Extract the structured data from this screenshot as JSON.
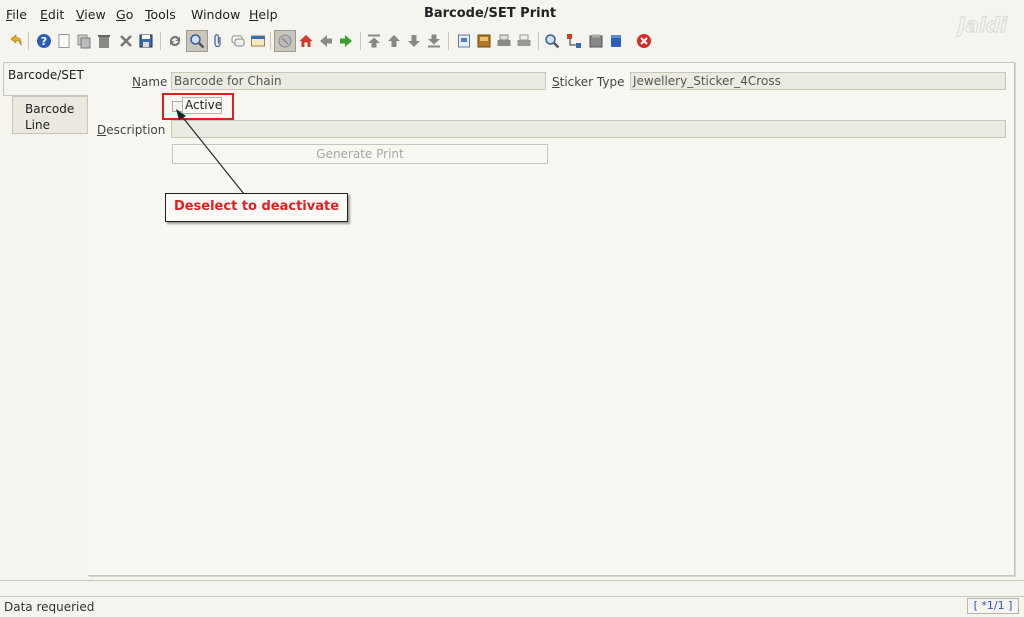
{
  "menu": {
    "file": {
      "u": "F",
      "rest": "ile"
    },
    "edit": {
      "u": "E",
      "rest": "dit"
    },
    "view": {
      "u": "V",
      "rest": "iew"
    },
    "go": {
      "u": "G",
      "rest": "o"
    },
    "tools": {
      "u": "T",
      "rest": "ools"
    },
    "window": "Window",
    "help": {
      "u": "H",
      "rest": "elp"
    }
  },
  "window_title": "Barcode/SET Print",
  "logo_text": "Jaldi",
  "tabs": [
    {
      "label": "Barcode/SET"
    },
    {
      "label_line1": "Barcode",
      "label_line2": "Line"
    }
  ],
  "form": {
    "name_label": {
      "u": "N",
      "rest": "ame"
    },
    "name_value": "Barcode for Chain",
    "sticker_label": {
      "u": "S",
      "rest": "ticker Type"
    },
    "sticker_value": "Jewellery_Sticker_4Cross",
    "active_label": "Active",
    "description_label": {
      "u": "D",
      "rest": "escription"
    },
    "description_value": "",
    "generate_button": "Generate Print"
  },
  "callout": {
    "text": "Deselect to deactivate",
    "color": "#e02020"
  },
  "status": {
    "message": "Data requeried",
    "position": "[ *1/1 ]"
  },
  "icons": [
    "undo-icon",
    "help-icon",
    "new-icon",
    "copy-icon",
    "delete-icon",
    "delete-selection-icon",
    "save-icon",
    "refresh-icon",
    "find-icon",
    "attachment-icon",
    "chat-icon",
    "history-icon",
    "grid-toggle-icon",
    "home-icon",
    "back-icon",
    "forward-icon",
    "first-record-icon",
    "previous-record-icon",
    "next-record-icon",
    "last-record-icon",
    "report-icon",
    "archive-icon",
    "print-icon",
    "print-preview-icon",
    "zoom-across-icon",
    "workflow-icon",
    "product-info-icon",
    "end-icon",
    "close-window-icon"
  ]
}
